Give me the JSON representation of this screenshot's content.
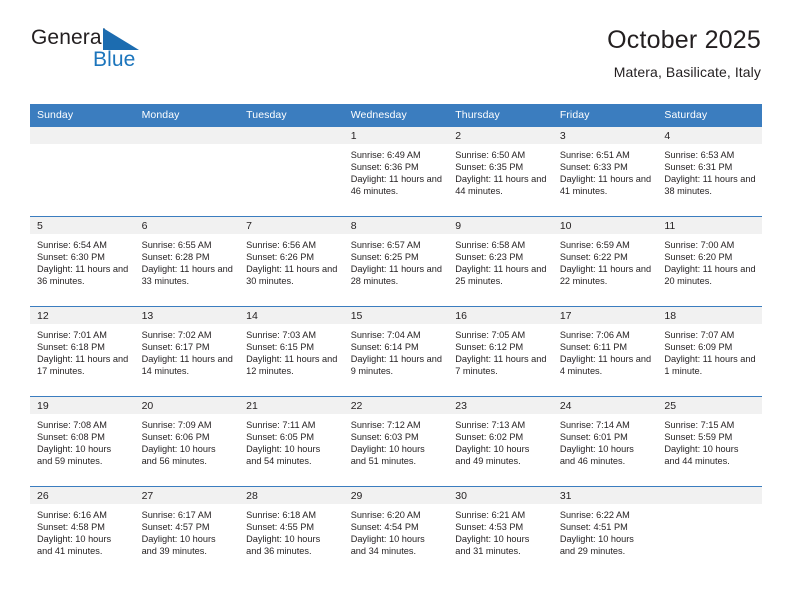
{
  "brand": {
    "name_part1": "General",
    "name_part2": "Blue",
    "logo_icon": "blue-triangle-icon"
  },
  "header": {
    "title": "October 2025",
    "location": "Matera, Basilicate, Italy"
  },
  "calendar": {
    "weekday_headers": [
      "Sunday",
      "Monday",
      "Tuesday",
      "Wednesday",
      "Thursday",
      "Friday",
      "Saturday"
    ],
    "accent_color": "#3b7dbf",
    "daynum_bg": "#f1f1f1",
    "weeks": [
      [
        {
          "day": "",
          "sunrise": "",
          "sunset": "",
          "daylight": ""
        },
        {
          "day": "",
          "sunrise": "",
          "sunset": "",
          "daylight": ""
        },
        {
          "day": "",
          "sunrise": "",
          "sunset": "",
          "daylight": ""
        },
        {
          "day": "1",
          "sunrise": "Sunrise: 6:49 AM",
          "sunset": "Sunset: 6:36 PM",
          "daylight": "Daylight: 11 hours and 46 minutes."
        },
        {
          "day": "2",
          "sunrise": "Sunrise: 6:50 AM",
          "sunset": "Sunset: 6:35 PM",
          "daylight": "Daylight: 11 hours and 44 minutes."
        },
        {
          "day": "3",
          "sunrise": "Sunrise: 6:51 AM",
          "sunset": "Sunset: 6:33 PM",
          "daylight": "Daylight: 11 hours and 41 minutes."
        },
        {
          "day": "4",
          "sunrise": "Sunrise: 6:53 AM",
          "sunset": "Sunset: 6:31 PM",
          "daylight": "Daylight: 11 hours and 38 minutes."
        }
      ],
      [
        {
          "day": "5",
          "sunrise": "Sunrise: 6:54 AM",
          "sunset": "Sunset: 6:30 PM",
          "daylight": "Daylight: 11 hours and 36 minutes."
        },
        {
          "day": "6",
          "sunrise": "Sunrise: 6:55 AM",
          "sunset": "Sunset: 6:28 PM",
          "daylight": "Daylight: 11 hours and 33 minutes."
        },
        {
          "day": "7",
          "sunrise": "Sunrise: 6:56 AM",
          "sunset": "Sunset: 6:26 PM",
          "daylight": "Daylight: 11 hours and 30 minutes."
        },
        {
          "day": "8",
          "sunrise": "Sunrise: 6:57 AM",
          "sunset": "Sunset: 6:25 PM",
          "daylight": "Daylight: 11 hours and 28 minutes."
        },
        {
          "day": "9",
          "sunrise": "Sunrise: 6:58 AM",
          "sunset": "Sunset: 6:23 PM",
          "daylight": "Daylight: 11 hours and 25 minutes."
        },
        {
          "day": "10",
          "sunrise": "Sunrise: 6:59 AM",
          "sunset": "Sunset: 6:22 PM",
          "daylight": "Daylight: 11 hours and 22 minutes."
        },
        {
          "day": "11",
          "sunrise": "Sunrise: 7:00 AM",
          "sunset": "Sunset: 6:20 PM",
          "daylight": "Daylight: 11 hours and 20 minutes."
        }
      ],
      [
        {
          "day": "12",
          "sunrise": "Sunrise: 7:01 AM",
          "sunset": "Sunset: 6:18 PM",
          "daylight": "Daylight: 11 hours and 17 minutes."
        },
        {
          "day": "13",
          "sunrise": "Sunrise: 7:02 AM",
          "sunset": "Sunset: 6:17 PM",
          "daylight": "Daylight: 11 hours and 14 minutes."
        },
        {
          "day": "14",
          "sunrise": "Sunrise: 7:03 AM",
          "sunset": "Sunset: 6:15 PM",
          "daylight": "Daylight: 11 hours and 12 minutes."
        },
        {
          "day": "15",
          "sunrise": "Sunrise: 7:04 AM",
          "sunset": "Sunset: 6:14 PM",
          "daylight": "Daylight: 11 hours and 9 minutes."
        },
        {
          "day": "16",
          "sunrise": "Sunrise: 7:05 AM",
          "sunset": "Sunset: 6:12 PM",
          "daylight": "Daylight: 11 hours and 7 minutes."
        },
        {
          "day": "17",
          "sunrise": "Sunrise: 7:06 AM",
          "sunset": "Sunset: 6:11 PM",
          "daylight": "Daylight: 11 hours and 4 minutes."
        },
        {
          "day": "18",
          "sunrise": "Sunrise: 7:07 AM",
          "sunset": "Sunset: 6:09 PM",
          "daylight": "Daylight: 11 hours and 1 minute."
        }
      ],
      [
        {
          "day": "19",
          "sunrise": "Sunrise: 7:08 AM",
          "sunset": "Sunset: 6:08 PM",
          "daylight": "Daylight: 10 hours and 59 minutes."
        },
        {
          "day": "20",
          "sunrise": "Sunrise: 7:09 AM",
          "sunset": "Sunset: 6:06 PM",
          "daylight": "Daylight: 10 hours and 56 minutes."
        },
        {
          "day": "21",
          "sunrise": "Sunrise: 7:11 AM",
          "sunset": "Sunset: 6:05 PM",
          "daylight": "Daylight: 10 hours and 54 minutes."
        },
        {
          "day": "22",
          "sunrise": "Sunrise: 7:12 AM",
          "sunset": "Sunset: 6:03 PM",
          "daylight": "Daylight: 10 hours and 51 minutes."
        },
        {
          "day": "23",
          "sunrise": "Sunrise: 7:13 AM",
          "sunset": "Sunset: 6:02 PM",
          "daylight": "Daylight: 10 hours and 49 minutes."
        },
        {
          "day": "24",
          "sunrise": "Sunrise: 7:14 AM",
          "sunset": "Sunset: 6:01 PM",
          "daylight": "Daylight: 10 hours and 46 minutes."
        },
        {
          "day": "25",
          "sunrise": "Sunrise: 7:15 AM",
          "sunset": "Sunset: 5:59 PM",
          "daylight": "Daylight: 10 hours and 44 minutes."
        }
      ],
      [
        {
          "day": "26",
          "sunrise": "Sunrise: 6:16 AM",
          "sunset": "Sunset: 4:58 PM",
          "daylight": "Daylight: 10 hours and 41 minutes."
        },
        {
          "day": "27",
          "sunrise": "Sunrise: 6:17 AM",
          "sunset": "Sunset: 4:57 PM",
          "daylight": "Daylight: 10 hours and 39 minutes."
        },
        {
          "day": "28",
          "sunrise": "Sunrise: 6:18 AM",
          "sunset": "Sunset: 4:55 PM",
          "daylight": "Daylight: 10 hours and 36 minutes."
        },
        {
          "day": "29",
          "sunrise": "Sunrise: 6:20 AM",
          "sunset": "Sunset: 4:54 PM",
          "daylight": "Daylight: 10 hours and 34 minutes."
        },
        {
          "day": "30",
          "sunrise": "Sunrise: 6:21 AM",
          "sunset": "Sunset: 4:53 PM",
          "daylight": "Daylight: 10 hours and 31 minutes."
        },
        {
          "day": "31",
          "sunrise": "Sunrise: 6:22 AM",
          "sunset": "Sunset: 4:51 PM",
          "daylight": "Daylight: 10 hours and 29 minutes."
        },
        {
          "day": "",
          "sunrise": "",
          "sunset": "",
          "daylight": ""
        }
      ]
    ]
  }
}
